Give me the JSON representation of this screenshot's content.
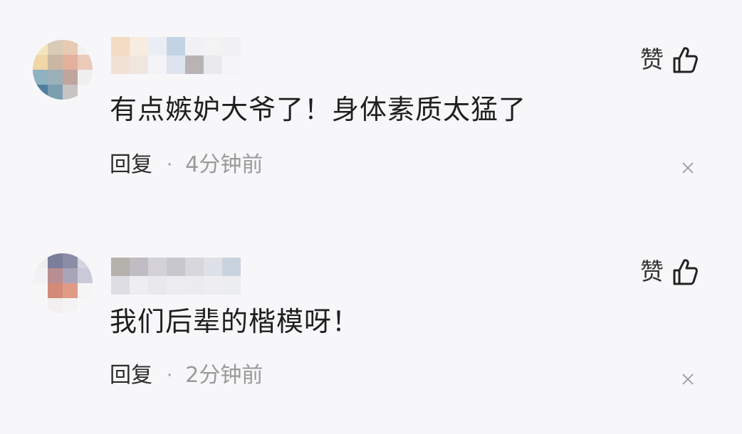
{
  "comments": [
    {
      "text": "有点嫉妒大爷了！身体素质太猛了",
      "like_label": "赞",
      "reply_label": "回复",
      "separator": "·",
      "time": "4分钟前",
      "avatar_tiles": [
        "#f3e6bf",
        "#d9cbb6",
        "#e8c9b2",
        "#f2f2f2",
        "#f0d7a8",
        "#c9b7a1",
        "#e3b19c",
        "#eccab9",
        "#8fb2c0",
        "#9bb0b9",
        "#bfa59d",
        "#f0efef",
        "#4f7fa0",
        "#7b9fae",
        "#c7c4c4",
        "#f6f6f6"
      ],
      "name_tiles": [
        "#f2dcc4",
        "#f1e0d4",
        "#f6ecdf",
        "#efe6df",
        "#eaeef4",
        "#f4f3f5",
        "#c4d3e3",
        "#dde4ee",
        "#f1f0f4",
        "#b9b3b5",
        "#f4f3f4",
        "#e9e9ee",
        "#f1f1f4",
        "#f5f5f7"
      ]
    },
    {
      "text": "我们后辈的楷模呀！",
      "like_label": "赞",
      "reply_label": "回复",
      "separator": "·",
      "time": "2分钟前",
      "avatar_tiles": [
        "#eeeeee",
        "#7c7f9a",
        "#8b8ca8",
        "#d4d3df",
        "#f2f2f4",
        "#b98e93",
        "#a9a4b8",
        "#c8c9d9",
        "#f7f7f7",
        "#d48a78",
        "#e09a86",
        "#f5f5f5",
        "#f7f7f7",
        "#f1efef",
        "#f3f3f3",
        "#f7f7f7"
      ],
      "name_tiles": [
        "#b4b1ac",
        "#dedde3",
        "#bfbcc4",
        "#eeedf0",
        "#d4d2d8",
        "#e9e8ed",
        "#c9c7ce",
        "#ececf1",
        "#d8d7db",
        "#ececef",
        "#dee1e8",
        "#ededf2",
        "#c9d3e0",
        "#ecedf1"
      ]
    }
  ]
}
